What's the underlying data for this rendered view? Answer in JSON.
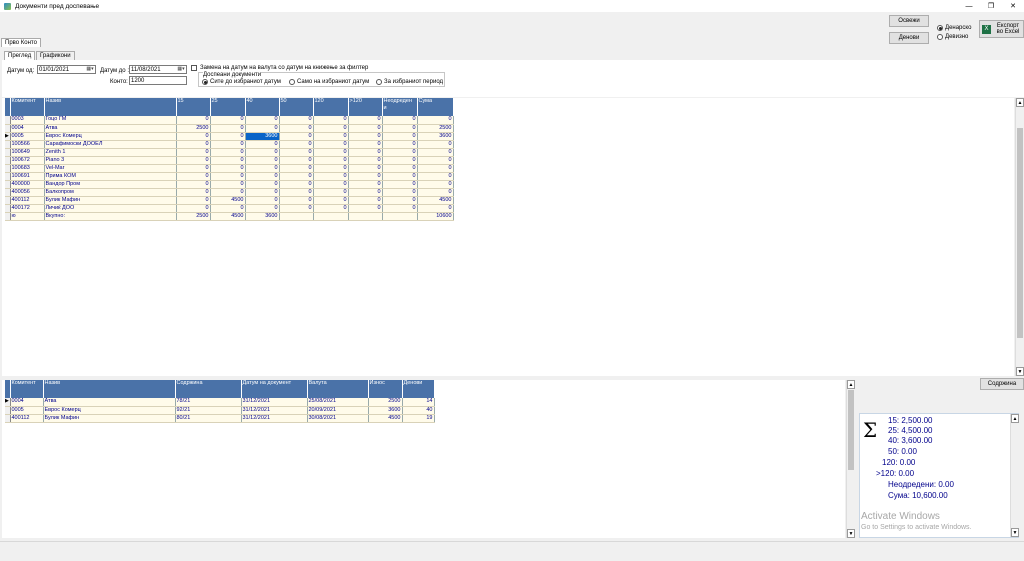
{
  "window": {
    "title": "Документи пред доспевање",
    "min": "—",
    "restore": "❐",
    "close": "✕"
  },
  "buttons": {
    "refresh": "Освежи",
    "days": "Денови",
    "export": "Експорт во Excel",
    "content": "Содржина"
  },
  "currency": {
    "options": [
      "Денарско",
      "Девизно"
    ],
    "selected": 0
  },
  "tabs": {
    "outer": "Прво Конто",
    "inner": [
      "Преглед",
      "Графикони"
    ],
    "active_inner": 0
  },
  "filters": {
    "date_from_label": "Датум од:",
    "date_from": "01/01/2021",
    "date_to_label": "Датум до :",
    "date_to": "11/08/2021",
    "account_label": "Конто:",
    "account": "1200",
    "replace_label": "Замена на датум на валута со датум на книжење за филтер",
    "due_docs_label": "Доспеани документи",
    "due_options": [
      "Сите до избраниот датум",
      "Само на избраниот датум",
      "За избраниот период"
    ],
    "due_selected": 0
  },
  "top_grid": {
    "columns": [
      "Комитент",
      "Назив",
      "15",
      "25",
      "40",
      "50",
      "120",
      ">120",
      "Неодреден и",
      "Сума"
    ],
    "rows": [
      [
        "0003",
        "Гоцо ГМ",
        "0",
        "0",
        "0",
        "0",
        "0",
        "0",
        "0",
        "0"
      ],
      [
        "0004",
        "Атва",
        "2500",
        "0",
        "0",
        "0",
        "0",
        "0",
        "0",
        "2500"
      ],
      [
        "0005",
        "Еврос Комерц",
        "0",
        "0",
        "3600",
        "0",
        "0",
        "0",
        "0",
        "3600"
      ],
      [
        "100566",
        "Сарафимоски ДООЕЛ",
        "0",
        "0",
        "0",
        "0",
        "0",
        "0",
        "0",
        "0"
      ],
      [
        "100649",
        "Zenith 1",
        "0",
        "0",
        "0",
        "0",
        "0",
        "0",
        "0",
        "0"
      ],
      [
        "100672",
        "Piano 3",
        "0",
        "0",
        "0",
        "0",
        "0",
        "0",
        "0",
        "0"
      ],
      [
        "100683",
        "Vel-Mar",
        "0",
        "0",
        "0",
        "0",
        "0",
        "0",
        "0",
        "0"
      ],
      [
        "100691",
        "Прима КОМ",
        "0",
        "0",
        "0",
        "0",
        "0",
        "0",
        "0",
        "0"
      ],
      [
        "400000",
        "Вандор Пром",
        "0",
        "0",
        "0",
        "0",
        "0",
        "0",
        "0",
        "0"
      ],
      [
        "400056",
        "Балкопром",
        "0",
        "0",
        "0",
        "0",
        "0",
        "0",
        "0",
        "0"
      ],
      [
        "400112",
        "Булик Мафин",
        "0",
        "4500",
        "0",
        "0",
        "0",
        "0",
        "0",
        "4500"
      ],
      [
        "400172",
        "Личиќ ДОО",
        "0",
        "0",
        "0",
        "0",
        "0",
        "0",
        "0",
        "0"
      ],
      [
        "ю",
        "Вкупно:",
        "2500",
        "4500",
        "3600",
        "",
        "",
        "",
        "",
        "10600"
      ]
    ],
    "selected_row": 2,
    "highlight_col": 4
  },
  "bottom_grid": {
    "columns": [
      "Комитент",
      "Назив",
      "Содржина",
      "Датум на документ",
      "Валута",
      "Износ",
      "Денови"
    ],
    "rows": [
      [
        "0004",
        "Атва",
        "78/21",
        "31/12/2021",
        "25/08/2021",
        "2500",
        "14"
      ],
      [
        "0005",
        "Еврос Комерц",
        "92/21",
        "31/12/2021",
        "20/09/2021",
        "3600",
        "40"
      ],
      [
        "400112",
        "Булик Мафин",
        "80/21",
        "31/12/2021",
        "30/08/2021",
        "4500",
        "19"
      ]
    ]
  },
  "summary": {
    "sigma": "Σ",
    "lines": [
      "15:   2,500.00",
      "25:   4,500.00",
      "40:   3,600.00",
      "50:   0.00",
      "120:   0.00",
      ">120:   0.00",
      "Неодредени:    0.00",
      "Сума:   10,600.00"
    ]
  },
  "watermark": {
    "title": "Activate Windows",
    "subtitle": "Go to Settings to activate Windows."
  }
}
